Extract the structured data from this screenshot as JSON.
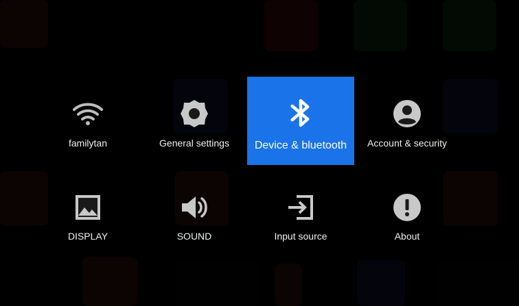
{
  "colors": {
    "selected_background": "#1a73e8",
    "icon_color": "#d0d0d0",
    "label_color": "#f0f0f0",
    "background": "#020202"
  },
  "menu": {
    "items": [
      {
        "label": "familytan",
        "icon": "wifi-icon"
      },
      {
        "label": "General settings",
        "icon": "gear-icon"
      },
      {
        "label": "Device & bluetooth",
        "icon": "bluetooth-icon",
        "selected": true
      },
      {
        "label": "Account & security",
        "icon": "account-icon"
      },
      {
        "label": "DISPLAY",
        "icon": "image-icon"
      },
      {
        "label": "SOUND",
        "icon": "speaker-icon"
      },
      {
        "label": "Input source",
        "icon": "input-source-icon"
      },
      {
        "label": "About",
        "icon": "info-alert-icon"
      }
    ]
  }
}
